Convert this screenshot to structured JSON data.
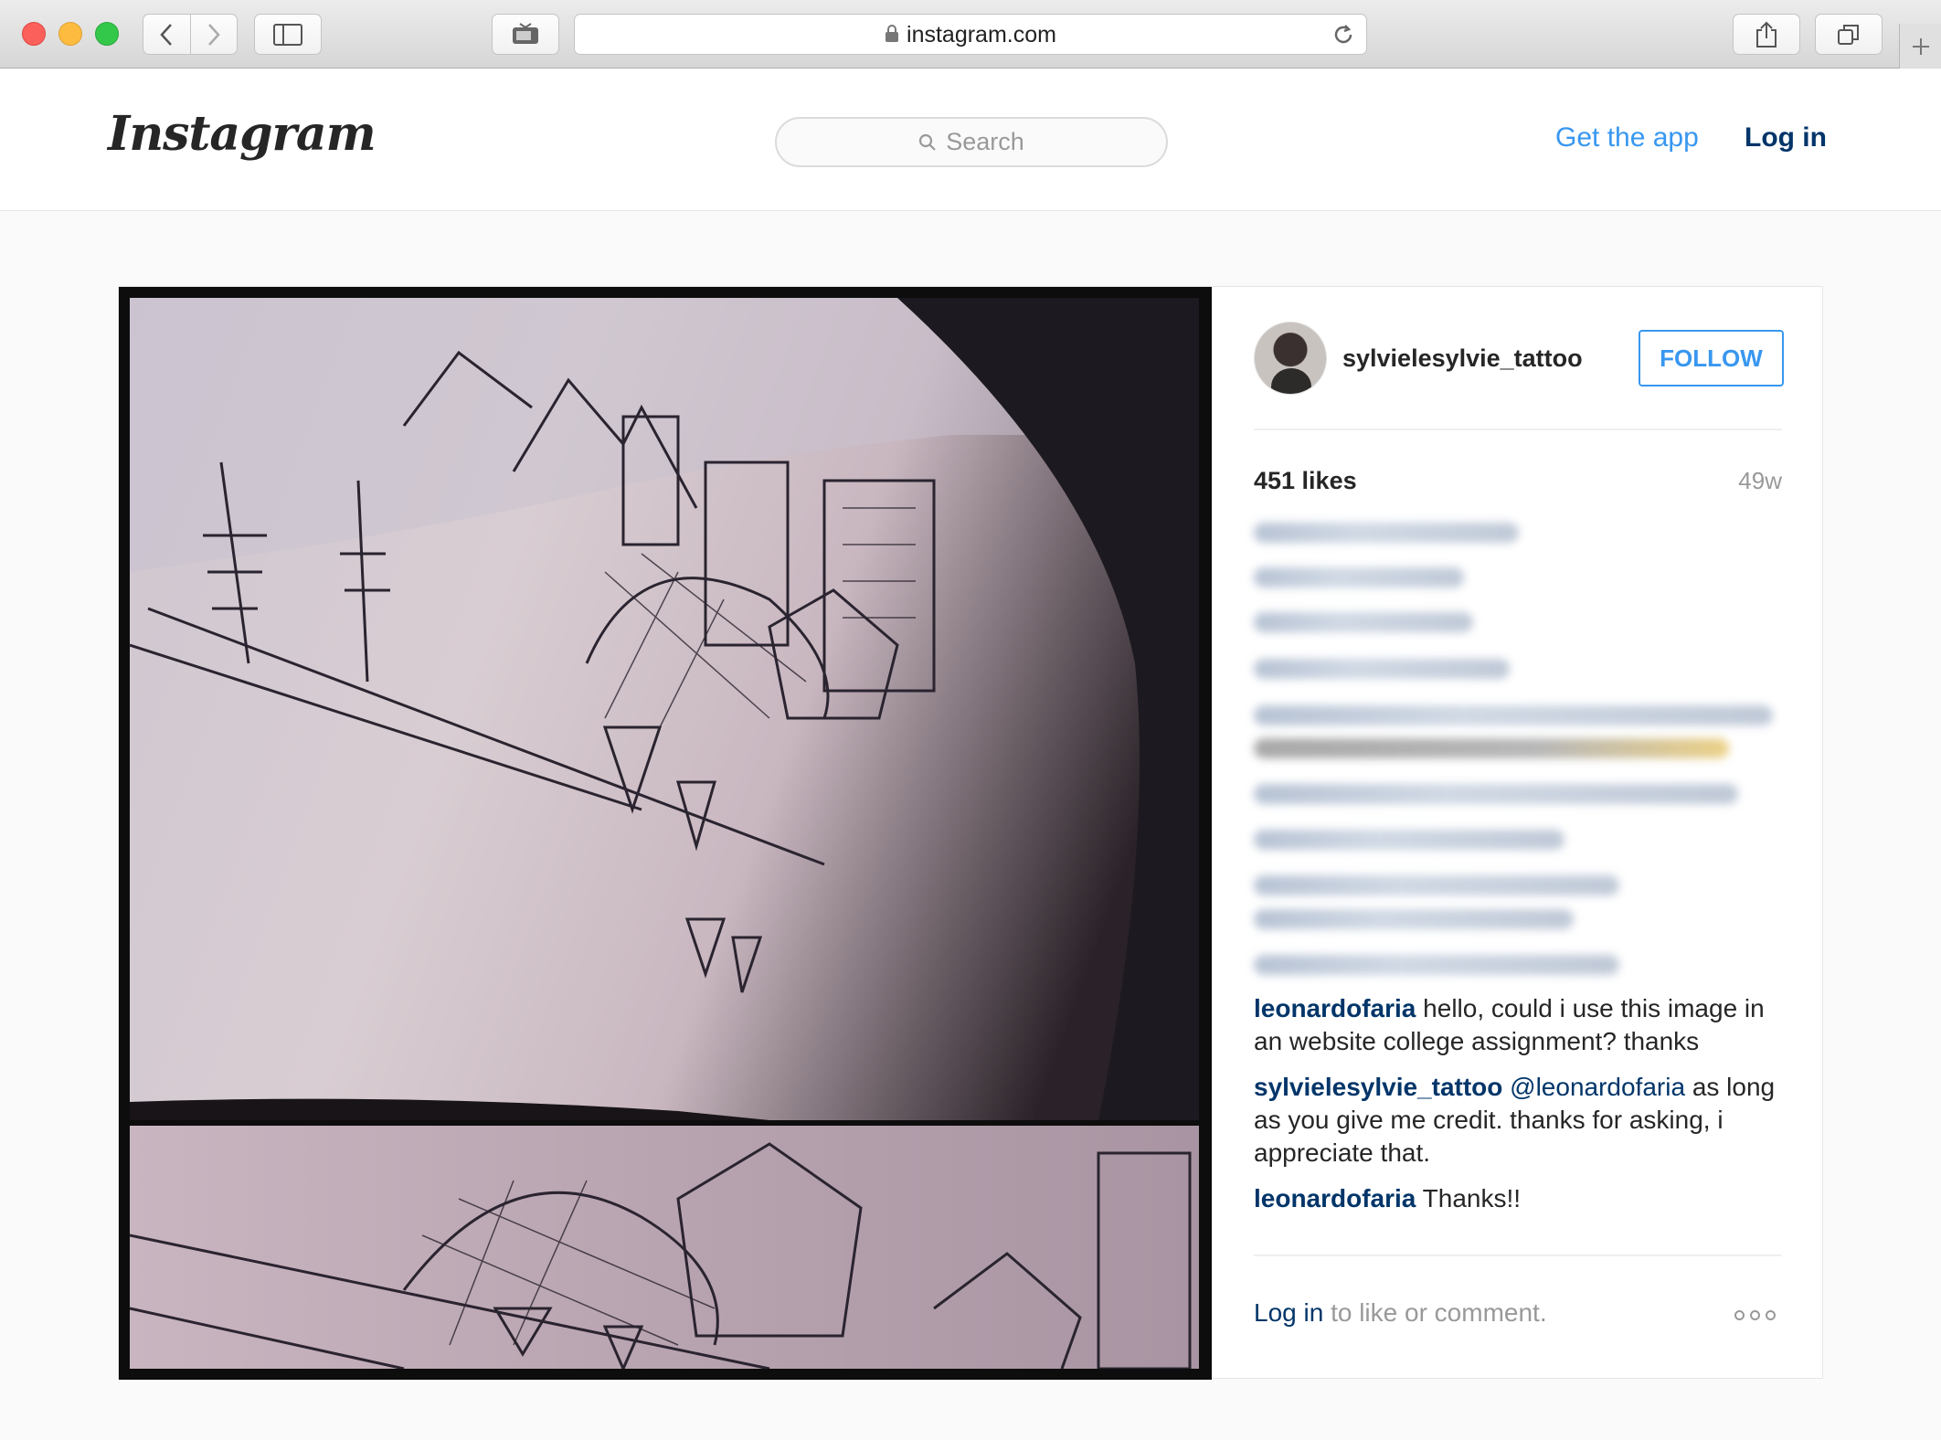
{
  "browser": {
    "url": "instagram.com"
  },
  "header": {
    "logo": "Instagram",
    "search_placeholder": "Search",
    "get_app": "Get the app",
    "log_in": "Log in"
  },
  "post": {
    "username": "sylvielesylvie_tattoo",
    "follow_label": "FOLLOW",
    "likes": "451 likes",
    "age": "49w",
    "comments": [
      {
        "user": "leonardofaria",
        "mention": "",
        "text": "hello, could i use this image in an website college assignment? thanks"
      },
      {
        "user": "sylvielesylvie_tattoo",
        "mention": "@leonardofaria",
        "text": "as long as you give me credit. thanks for asking, i appreciate that."
      },
      {
        "user": "leonardofaria",
        "mention": "",
        "text": "Thanks!!"
      }
    ],
    "footer_link": "Log in",
    "footer_text": "to like or comment."
  },
  "colors": {
    "link_blue": "#3897f0",
    "dark_link": "#003569",
    "text": "#262626",
    "muted": "#999999"
  },
  "icons": [
    "back-icon",
    "forward-icon",
    "sidebar-icon",
    "media-icon",
    "lock-icon",
    "reload-icon",
    "share-icon",
    "tabs-icon",
    "plus-icon",
    "search-icon",
    "more-icon"
  ]
}
